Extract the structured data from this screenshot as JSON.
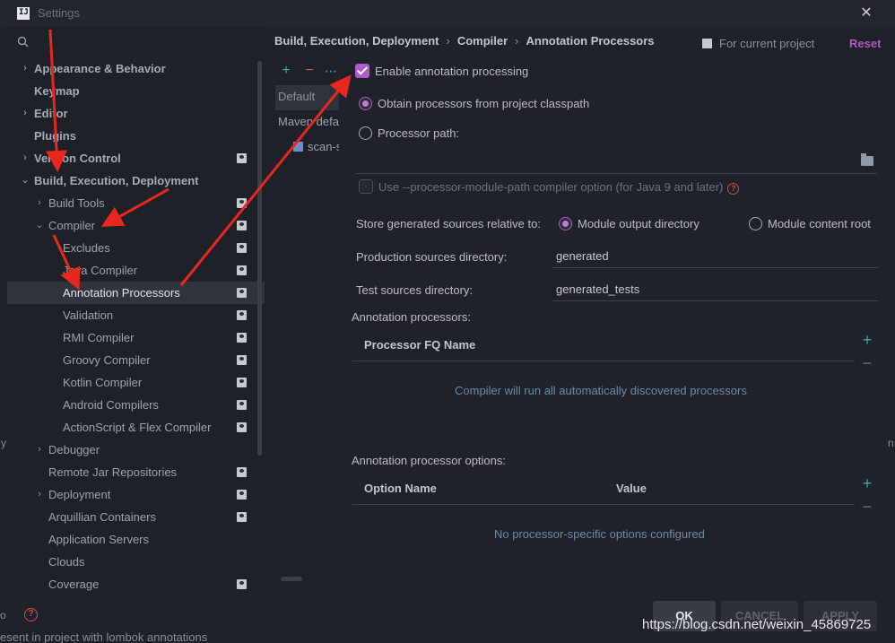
{
  "window": {
    "title": "Settings",
    "close_glyph": "✕",
    "app_icon_text": "IJ"
  },
  "search": {
    "placeholder": ""
  },
  "tree": [
    {
      "label": "Appearance & Behavior",
      "chevron": "›",
      "indent": 0,
      "bold": true,
      "project": false
    },
    {
      "label": "Keymap",
      "chevron": "",
      "indent": 0,
      "bold": true,
      "project": false
    },
    {
      "label": "Editor",
      "chevron": "›",
      "indent": 0,
      "bold": true,
      "project": false
    },
    {
      "label": "Plugins",
      "chevron": "",
      "indent": 0,
      "bold": true,
      "project": false
    },
    {
      "label": "Version Control",
      "chevron": "›",
      "indent": 0,
      "bold": true,
      "project": true
    },
    {
      "label": "Build, Execution, Deployment",
      "chevron": "⌄",
      "indent": 0,
      "bold": true,
      "project": false
    },
    {
      "label": "Build Tools",
      "chevron": "›",
      "indent": 1,
      "bold": false,
      "project": true
    },
    {
      "label": "Compiler",
      "chevron": "⌄",
      "indent": 1,
      "bold": false,
      "project": true
    },
    {
      "label": "Excludes",
      "chevron": "",
      "indent": 2,
      "bold": false,
      "project": true
    },
    {
      "label": "Java Compiler",
      "chevron": "",
      "indent": 2,
      "bold": false,
      "project": true
    },
    {
      "label": "Annotation Processors",
      "chevron": "",
      "indent": 2,
      "bold": false,
      "project": true,
      "selected": true
    },
    {
      "label": "Validation",
      "chevron": "",
      "indent": 2,
      "bold": false,
      "project": true
    },
    {
      "label": "RMI Compiler",
      "chevron": "",
      "indent": 2,
      "bold": false,
      "project": true
    },
    {
      "label": "Groovy Compiler",
      "chevron": "",
      "indent": 2,
      "bold": false,
      "project": true
    },
    {
      "label": "Kotlin Compiler",
      "chevron": "",
      "indent": 2,
      "bold": false,
      "project": true
    },
    {
      "label": "Android Compilers",
      "chevron": "",
      "indent": 2,
      "bold": false,
      "project": true
    },
    {
      "label": "ActionScript & Flex Compiler",
      "chevron": "",
      "indent": 2,
      "bold": false,
      "project": true
    },
    {
      "label": "Debugger",
      "chevron": "›",
      "indent": 1,
      "bold": false,
      "project": false
    },
    {
      "label": "Remote Jar Repositories",
      "chevron": "",
      "indent": 1,
      "bold": false,
      "project": true
    },
    {
      "label": "Deployment",
      "chevron": "›",
      "indent": 1,
      "bold": false,
      "project": true
    },
    {
      "label": "Arquillian Containers",
      "chevron": "",
      "indent": 1,
      "bold": false,
      "project": true
    },
    {
      "label": "Application Servers",
      "chevron": "",
      "indent": 1,
      "bold": false,
      "project": false
    },
    {
      "label": "Clouds",
      "chevron": "",
      "indent": 1,
      "bold": false,
      "project": false
    },
    {
      "label": "Coverage",
      "chevron": "",
      "indent": 1,
      "bold": false,
      "project": true
    }
  ],
  "profiles": {
    "add": "+",
    "remove": "−",
    "more": "⋯",
    "items": [
      "Default",
      "Maven default",
      "scan-s"
    ]
  },
  "breadcrumb": [
    "Build, Execution, Deployment",
    "Compiler",
    "Annotation Processors"
  ],
  "breadcrumb_sep": "›",
  "for_current_project": "For current project",
  "reset": "Reset",
  "enable_annotation_processing": "Enable annotation processing",
  "obtain_from_classpath": "Obtain processors from project classpath",
  "processor_path": "Processor path:",
  "module_path_option": "Use --processor-module-path compiler option (for Java 9 and later)",
  "help_glyph": "?",
  "store_relative_label": "Store generated sources relative to:",
  "module_output_directory": "Module output directory",
  "module_content_root": "Module content root",
  "production_sources_label": "Production sources directory:",
  "production_sources_value": "generated",
  "test_sources_label": "Test sources directory:",
  "test_sources_value": "generated_tests",
  "annotation_processors_label": "Annotation processors:",
  "processor_fq_name": "Processor FQ Name",
  "processors_empty": "Compiler will run all automatically discovered processors",
  "processor_options_label": "Annotation processor options:",
  "option_name": "Option Name",
  "value": "Value",
  "options_empty": "No processor-specific options configured",
  "plus": "+",
  "minus": "−",
  "buttons": {
    "ok": "OK",
    "cancel": "CANCEL",
    "apply": "APPLY"
  },
  "bottom_text": "esent in project with lombok annotations",
  "watermark": "https://blog.csdn.net/weixin_45869725",
  "edge_left": "y",
  "edge_left2": "o",
  "edge_right": "n",
  "colors": {
    "accent": "#b05cc8",
    "arrow": "#e8281e",
    "background": "#1f2229",
    "link": "#b257c9",
    "add": "#3fa6b5"
  }
}
